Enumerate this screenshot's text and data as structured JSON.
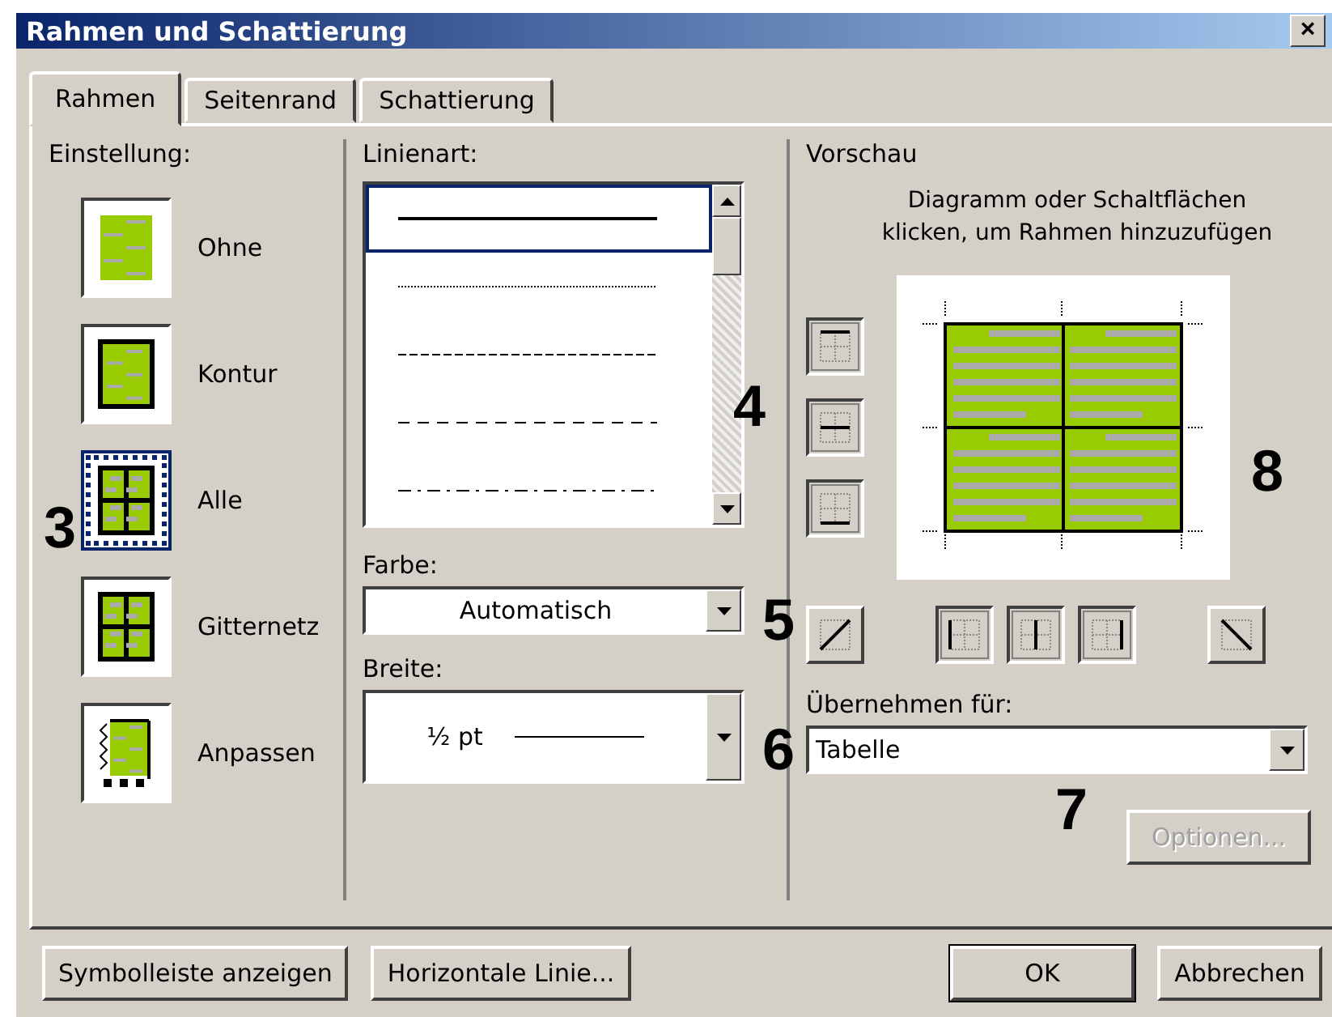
{
  "window": {
    "title": "Rahmen und Schattierung",
    "close": "×"
  },
  "tabs": [
    {
      "label": "Rahmen",
      "selected": true
    },
    {
      "label": "Seitenrand",
      "selected": false
    },
    {
      "label": "Schattierung",
      "selected": false
    }
  ],
  "settings": {
    "label": "Einstellung:",
    "items": [
      {
        "label": "Ohne",
        "kind": "none",
        "selected": false
      },
      {
        "label": "Kontur",
        "kind": "box",
        "selected": false
      },
      {
        "label": "Alle",
        "kind": "all",
        "selected": true
      },
      {
        "label": "Gitternetz",
        "kind": "grid",
        "selected": false
      },
      {
        "label": "Anpassen",
        "kind": "custom",
        "selected": false
      }
    ]
  },
  "line_style": {
    "label": "Linienart:",
    "items": [
      {
        "kind": "solid",
        "selected": true
      },
      {
        "kind": "dotted",
        "selected": false
      },
      {
        "kind": "dashed",
        "selected": false
      },
      {
        "kind": "longdash",
        "selected": false
      },
      {
        "kind": "dashdot",
        "selected": false
      }
    ]
  },
  "color": {
    "label": "Farbe:",
    "value": "Automatisch"
  },
  "width": {
    "label": "Breite:",
    "value": "½ pt"
  },
  "preview": {
    "label": "Vorschau",
    "hint": "Diagramm oder Schaltflächen klicken, um Rahmen hinzuzufügen",
    "side_buttons": [
      {
        "kind": "top",
        "pressed": true
      },
      {
        "kind": "hmiddle",
        "pressed": true
      },
      {
        "kind": "bottom",
        "pressed": true
      }
    ],
    "bottom_buttons": [
      {
        "kind": "diagup",
        "pressed": false
      },
      {
        "kind": "left",
        "pressed": true
      },
      {
        "kind": "vmiddle",
        "pressed": true
      },
      {
        "kind": "right",
        "pressed": true
      },
      {
        "kind": "diagdown",
        "pressed": false
      }
    ]
  },
  "apply_to": {
    "label": "Übernehmen für:",
    "value": "Tabelle"
  },
  "options_button": {
    "label": "Optionen...",
    "disabled": true
  },
  "footer": {
    "left": [
      "Symbolleiste anzeigen",
      "Horizontale Linie..."
    ],
    "ok": "OK",
    "cancel": "Abbrechen"
  },
  "callouts": [
    "3",
    "4",
    "5",
    "6",
    "7",
    "8"
  ]
}
